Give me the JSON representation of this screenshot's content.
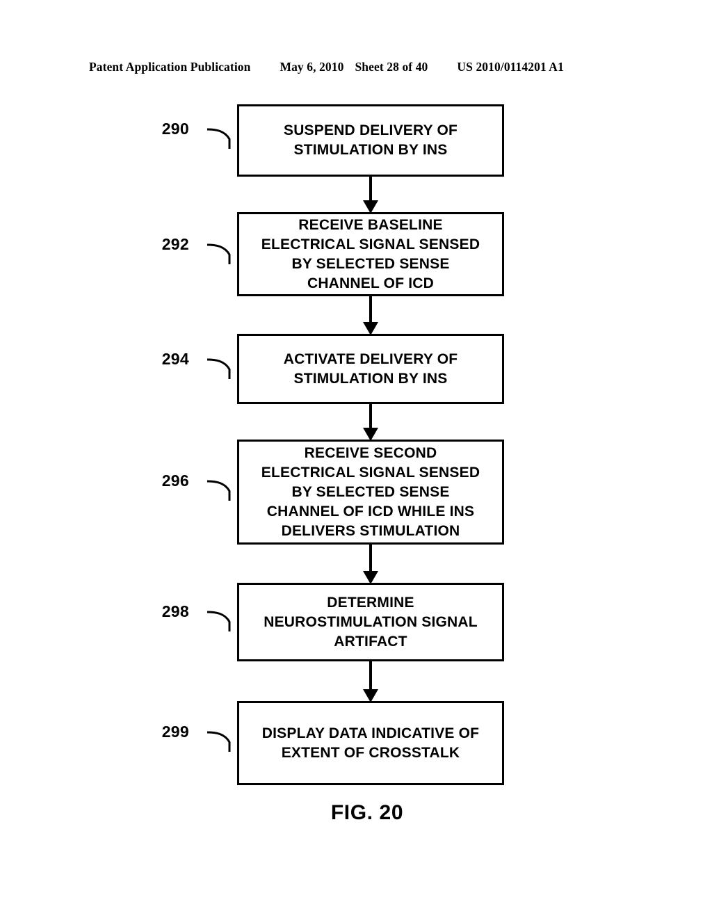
{
  "header": {
    "publication": "Patent Application Publication",
    "date": "May 6, 2010",
    "sheet": "Sheet 28 of 40",
    "patent_number": "US 2010/0114201 A1"
  },
  "figure": {
    "caption": "FIG. 20",
    "line_color": "#000000",
    "background_color": "#ffffff"
  },
  "flowchart": {
    "nodes": [
      {
        "ref": "290",
        "text": "SUSPEND DELIVERY OF\nSTIMULATION BY INS"
      },
      {
        "ref": "292",
        "text": "RECEIVE BASELINE\nELECTRICAL SIGNAL SENSED\nBY SELECTED SENSE\nCHANNEL OF ICD"
      },
      {
        "ref": "294",
        "text": "ACTIVATE DELIVERY OF\nSTIMULATION BY INS"
      },
      {
        "ref": "296",
        "text": "RECEIVE SECOND\nELECTRICAL SIGNAL SENSED\nBY SELECTED SENSE\nCHANNEL OF ICD WHILE INS\nDELIVERS STIMULATION"
      },
      {
        "ref": "298",
        "text": "DETERMINE\nNEUROSTIMULATION SIGNAL\nARTIFACT"
      },
      {
        "ref": "299",
        "text": "DISPLAY DATA INDICATIVE OF\nEXTENT OF CROSSTALK"
      }
    ]
  }
}
